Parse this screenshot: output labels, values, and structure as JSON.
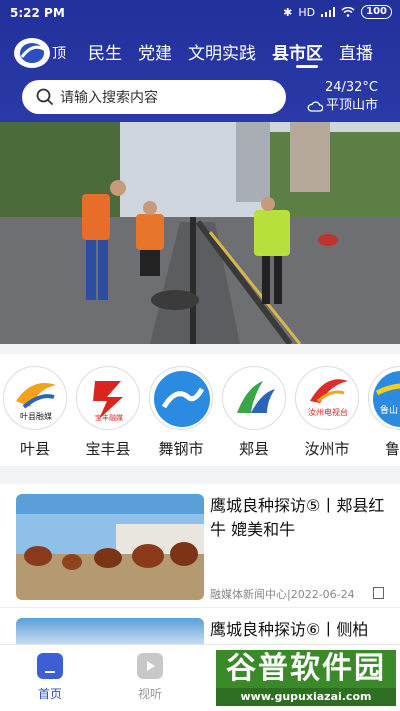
{
  "statusbar": {
    "time": "5:22 PM",
    "network": "HD",
    "battery": "100"
  },
  "nav": {
    "logo_text": "顶",
    "tabs": [
      "民生",
      "党建",
      "文明实践",
      "县市区",
      "直播"
    ],
    "active_tab": "县市区"
  },
  "search": {
    "placeholder": "请输入搜索内容"
  },
  "weather": {
    "temperature": "24/32°C",
    "location": "平顶山市"
  },
  "channels": [
    {
      "name": "叶县",
      "logo_text": "叶县融媒"
    },
    {
      "name": "宝丰县",
      "logo_text": "宝丰融媒"
    },
    {
      "name": "舞钢市",
      "logo_text": ""
    },
    {
      "name": "郏县",
      "logo_text": ""
    },
    {
      "name": "汝州市",
      "logo_text": "汝州电视台"
    },
    {
      "name": "鲁山",
      "logo_text": "鲁山"
    }
  ],
  "news": [
    {
      "title": "鹰城良种探访⑤丨郏县红牛 媲美和牛",
      "source": "融媒体新闻中心",
      "date": "2022-06-24"
    },
    {
      "title": "鹰城良种探访⑥丨侧柏",
      "source": "",
      "date": ""
    }
  ],
  "tabbar": {
    "home": "首页",
    "video": "视听"
  },
  "watermark": {
    "brand": "谷普软件园",
    "url": "www.gupuxiazai.com"
  },
  "colors": {
    "header": "#21309a",
    "accent": "#2c4fc4",
    "tab_active": "#2c4fc4"
  }
}
